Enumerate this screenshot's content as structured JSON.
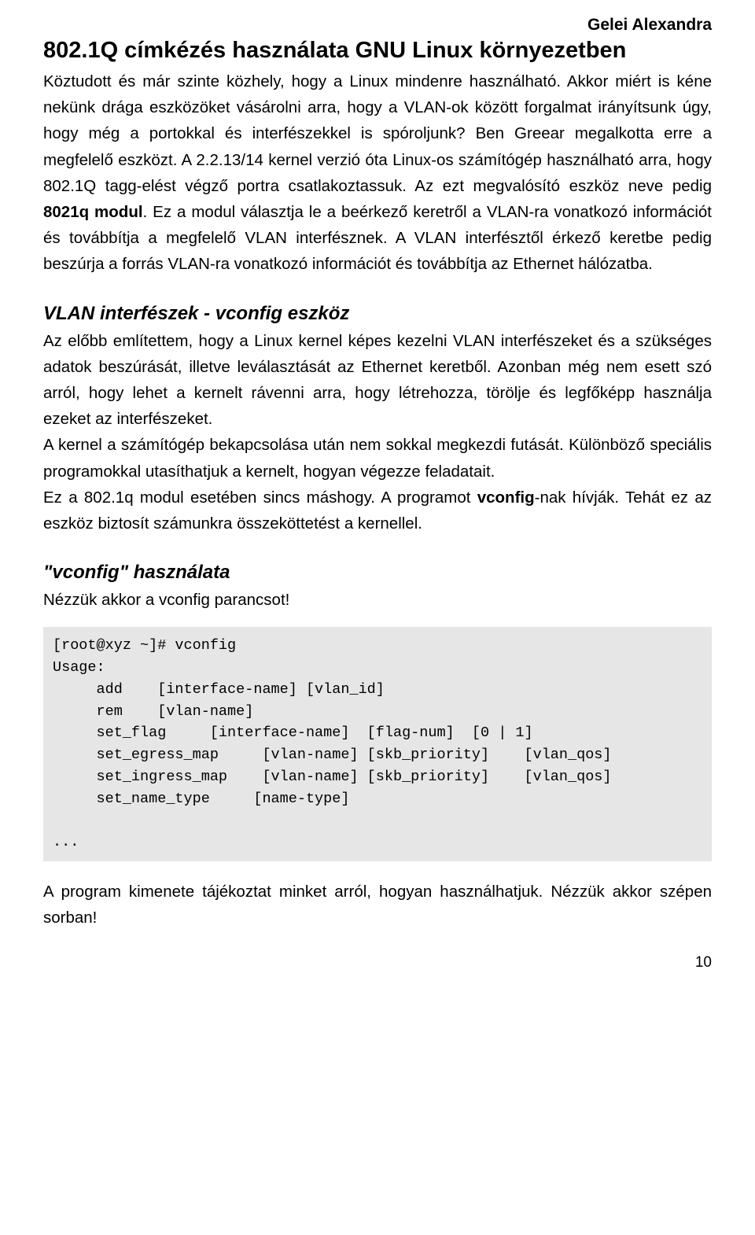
{
  "author": "Gelei Alexandra",
  "title": "802.1Q címkézés használata GNU Linux környezetben",
  "para1_a": "Köztudott és már szinte közhely, hogy a Linux mindenre használható. Akkor miért is kéne nekünk drága eszközöket vásárolni arra, hogy a VLAN-ok között forgalmat irányítsunk úgy, hogy még a portokkal és interfészekkel is spóroljunk? Ben Greear megalkotta erre a megfelelő eszközt. A 2.2.13/14 kernel verzió óta Linux-os számítógép használható arra, hogy 802.1Q tagg-elést végző portra csatlakoztassuk. Az ezt megvalósító eszköz neve pedig ",
  "para1_bold1": "8021q modul",
  "para1_b": ". Ez a modul választja le a beérkező keretről a VLAN-ra vonatkozó információt és továbbítja a megfelelő VLAN interfésznek. A VLAN interfésztől érkező keretbe pedig beszúrja a forrás VLAN-ra vonatkozó információt és továbbítja az Ethernet hálózatba.",
  "section2_heading": "VLAN interfészek - vconfig eszköz",
  "para2_a": "Az előbb említettem, hogy a Linux kernel képes kezelni VLAN interfészeket és a szükséges adatok beszúrását, illetve leválasztását az Ethernet keretből. Azonban még nem esett szó arról, hogy lehet a kernelt rávenni arra, hogy létrehozza, törölje és legfőképp használja ezeket az interfészeket.",
  "para2_b": "A kernel a számítógép bekapcsolása után nem sokkal megkezdi futását. Különböző speciális programokkal utasíthatjuk a kernelt, hogyan végezze feladatait.",
  "para2_c_before": " Ez a 802.1q modul esetében sincs máshogy. A programot ",
  "para2_c_bold": "vconfig",
  "para2_c_after": "-nak hívják. Tehát ez az eszköz biztosít számunkra összeköttetést a kernellel.",
  "section3_heading": "\"vconfig\" használata",
  "para3": "Nézzük akkor a vconfig parancsot!",
  "code": "[root@xyz ~]# vconfig\nUsage:\n     add    [interface-name] [vlan_id]\n     rem    [vlan-name]\n     set_flag     [interface-name]  [flag-num]  [0 | 1]\n     set_egress_map     [vlan-name] [skb_priority]    [vlan_qos]\n     set_ingress_map    [vlan-name] [skb_priority]    [vlan_qos]\n     set_name_type     [name-type]\n\n...",
  "para4": "A program kimenete tájékoztat minket arról, hogyan használhatjuk. Nézzük akkor szépen sorban!",
  "page_number": "10"
}
